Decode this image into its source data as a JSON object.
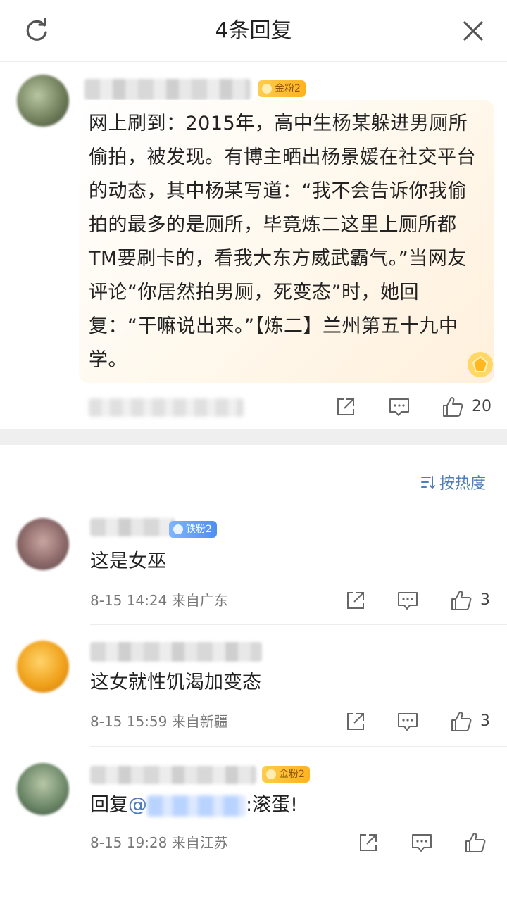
{
  "header": {
    "title": "4条回复"
  },
  "post": {
    "badge": "金粉2",
    "text": "网上刷到：2015年，高中生杨某躲进男厕所偷拍，被发现。有博主晒出杨景媛在社交平台的动态，其中杨某写道：“我不会告诉你我偷拍的最多的是厕所，毕竟炼二这里上厕所都TM要刷卡的，看我大东方威武霸气。”当网友评论“你居然拍男厕，死变态”时，她回复：“干嘛说出来。”【炼二】兰州第五十九中学。",
    "like_count": "20"
  },
  "sort": {
    "label": "按热度"
  },
  "comments": [
    {
      "badge": "铁粉2",
      "text": "这是女巫",
      "meta": "8-15 14:24  来自广东",
      "likes": "3"
    },
    {
      "badge": "",
      "text": "这女就性饥渴加变态",
      "meta": "8-15 15:59  来自新疆",
      "likes": "3"
    },
    {
      "badge": "金粉2",
      "reply_prefix": "回复",
      "mention_at": "@",
      "reply_suffix": ":滚蛋!",
      "meta": "8-15 19:28  来自江苏",
      "likes": ""
    }
  ],
  "icons": {
    "refresh": "refresh-icon",
    "close": "close-icon",
    "share": "share-icon",
    "comment": "comment-icon",
    "like": "like-icon",
    "sort": "sort-icon",
    "gem": "gem-icon"
  },
  "colors": {
    "link": "#4f7db8",
    "gold_badge": "#ffbe2e",
    "iron_badge": "#5f9bf5"
  }
}
